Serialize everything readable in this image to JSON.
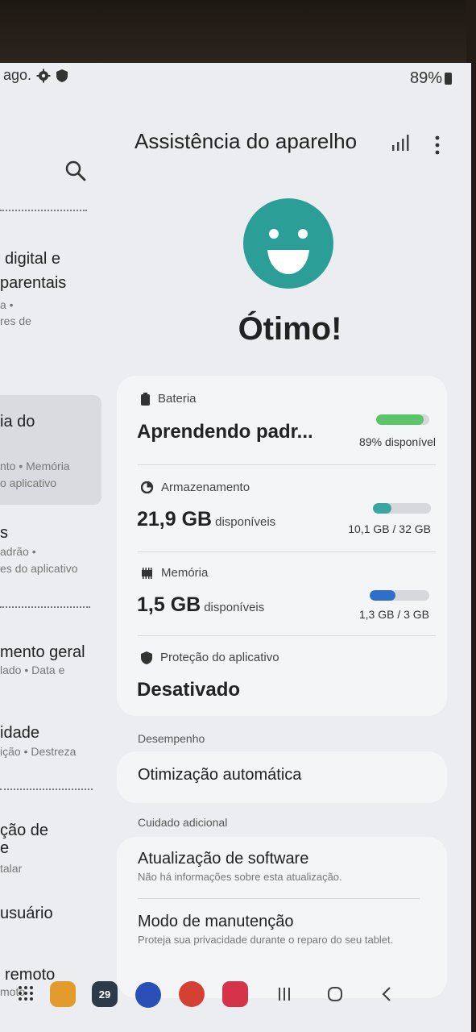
{
  "statusbar": {
    "date_fragment": "ago.",
    "battery_percent": "89%"
  },
  "left_panel": {
    "items": [
      {
        "title_1": "digital e",
        "title_2": "parentais",
        "sub_1": "a •",
        "sub_2": "res de"
      },
      {
        "title_1": "ia do",
        "sub_1": "nto • Memória",
        "sub_2": "o aplicativo"
      },
      {
        "title_1": "s",
        "sub_1": "adrão •",
        "sub_2": "es do aplicativo"
      },
      {
        "title_1": "mento geral",
        "sub_1": "lado • Data e"
      },
      {
        "title_1": "idade",
        "sub_1": "ição • Destreza"
      },
      {
        "title_1": "ção de",
        "title_2": "e",
        "sub_1": "talar"
      },
      {
        "title_1": "usuário"
      },
      {
        "title_1": "remoto",
        "sub_1": "moto"
      }
    ]
  },
  "header": {
    "title": "Assistência do aparelho"
  },
  "overall_status": "Ótimo!",
  "battery": {
    "label": "Bateria",
    "value": "Aprendendo padr...",
    "detail": "89% disponível",
    "level": 0.89,
    "color": "#5cc46a"
  },
  "storage": {
    "label": "Armazenamento",
    "value": "21,9 GB",
    "unit": "disponíveis",
    "detail": "10,1 GB / 32 GB",
    "used_fraction": 0.32,
    "color": "#3aa6a2"
  },
  "memory": {
    "label": "Memória",
    "value": "1,5 GB",
    "unit": "disponíveis",
    "detail": "1,3 GB / 3 GB",
    "used_fraction": 0.43,
    "color": "#2f6fc9"
  },
  "app_protection": {
    "label": "Proteção do aplicativo",
    "value": "Desativado"
  },
  "performance": {
    "section": "Desempenho",
    "auto_optimization": "Otimização automática"
  },
  "extra_care": {
    "section": "Cuidado adicional",
    "software_update_title": "Atualização de software",
    "software_update_sub": "Não há informações sobre esta atualização.",
    "maintenance_title": "Modo de manutenção",
    "maintenance_sub": "Proteja sua privacidade durante o reparo do seu tablet."
  },
  "dock": {
    "calendar_day": "29"
  }
}
